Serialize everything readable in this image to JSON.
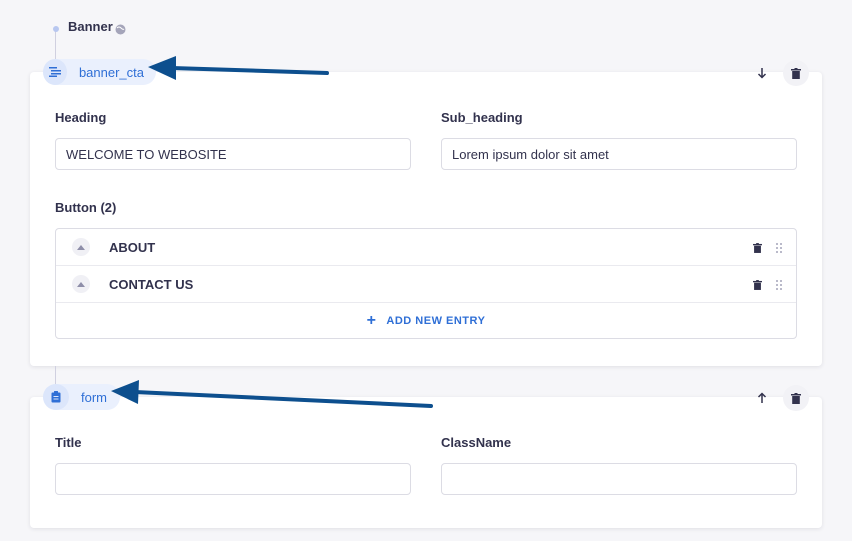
{
  "header": {
    "section_title": "Banner"
  },
  "components": [
    {
      "name": "banner_cta",
      "fields": [
        {
          "label": "Heading",
          "value": "WELCOME TO WEBOSITE"
        },
        {
          "label": "Sub_heading",
          "value": "Lorem ipsum dolor sit amet"
        }
      ],
      "repeatable": {
        "label": "Button (2)",
        "entries": [
          "ABOUT",
          "CONTACT US"
        ],
        "add_label": "ADD NEW ENTRY"
      }
    },
    {
      "name": "form",
      "fields": [
        {
          "label": "Title",
          "value": ""
        },
        {
          "label": "ClassName",
          "value": ""
        }
      ]
    }
  ],
  "colors": {
    "accent": "#2f6fd6",
    "annotation_arrow": "#0d4f8e"
  },
  "icons": [
    "globe-icon",
    "list-icon",
    "clipboard-icon",
    "arrow-down-icon",
    "arrow-up-icon",
    "trash-icon",
    "caret-up-icon",
    "drag-handle-icon",
    "plus-icon"
  ]
}
